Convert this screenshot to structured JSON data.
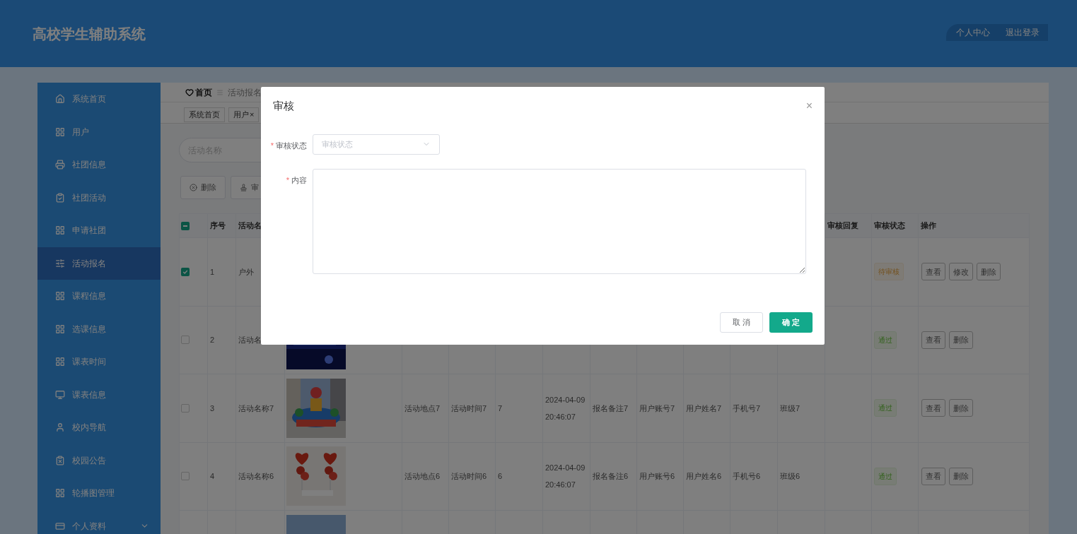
{
  "header": {
    "title": "高校学生辅助系统",
    "links": [
      {
        "label": "个人中心"
      },
      {
        "label": "退出登录"
      }
    ]
  },
  "sidebar": {
    "items": [
      {
        "label": "系统首页",
        "selected": false
      },
      {
        "label": "用户",
        "selected": false
      },
      {
        "label": "社团信息",
        "selected": false
      },
      {
        "label": "社团活动",
        "selected": false
      },
      {
        "label": "申请社团",
        "selected": false
      },
      {
        "label": "活动报名",
        "selected": true
      },
      {
        "label": "课程信息",
        "selected": false
      },
      {
        "label": "选课信息",
        "selected": false
      },
      {
        "label": "课表时间",
        "selected": false
      },
      {
        "label": "课表信息",
        "selected": false
      },
      {
        "label": "校内导航",
        "selected": false
      },
      {
        "label": "校园公告",
        "selected": false
      },
      {
        "label": "轮播图管理",
        "selected": false
      },
      {
        "label": "个人资料",
        "selected": false,
        "expandable": true
      }
    ]
  },
  "breadcrumb": [
    {
      "label": "首页"
    },
    {
      "label": "活动报名"
    }
  ],
  "tabs": [
    {
      "label": "系统首页"
    },
    {
      "label": "用户",
      "close": "×"
    }
  ],
  "search": {
    "placeholder": "活动名称"
  },
  "toolbar": [
    {
      "label": "删除",
      "kind": "delete"
    },
    {
      "label": "审",
      "kind": "review"
    }
  ],
  "table": {
    "header_checkbox": {
      "indeterminate": true
    },
    "columns": {
      "index": "序号",
      "name": "活动名",
      "reply": "审核回复",
      "status": "审核状态",
      "actions": "操作"
    },
    "rows": [
      {
        "checked": true,
        "index": "1",
        "name": "户外",
        "status": "待审核",
        "kind": "pending",
        "actions": [
          {
            "label": "查看"
          },
          {
            "label": "修改"
          },
          {
            "label": "删除"
          }
        ]
      },
      {
        "checked": false,
        "index": "2",
        "name": "活动名",
        "image": {
          "kind": "picture"
        },
        "status": "通过",
        "kind": "pass",
        "actions": [
          {
            "label": "查看"
          },
          {
            "label": "删除"
          }
        ]
      },
      {
        "checked": false,
        "index": "3",
        "name": "活动名称7",
        "image": {
          "kind": "picture"
        },
        "location": "活动地点7",
        "time": "活动时间7",
        "count": "7",
        "date": "2024-04-09 20:46:07",
        "note": "报名备注7",
        "account": "用户账号7",
        "username": "用户姓名7",
        "phone": "手机号7",
        "class": "班级7",
        "status": "通过",
        "kind": "pass",
        "actions": [
          {
            "label": "查看"
          },
          {
            "label": "删除"
          }
        ]
      },
      {
        "checked": false,
        "index": "4",
        "name": "活动名称6",
        "image": {
          "kind": "picture"
        },
        "location": "活动地点6",
        "time": "活动时间6",
        "count": "6",
        "date": "2024-04-09 20:46:07",
        "note": "报名备注6",
        "account": "用户账号6",
        "username": "用户姓名6",
        "phone": "手机号6",
        "class": "班级6",
        "status": "通过",
        "kind": "pass",
        "actions": [
          {
            "label": "查看"
          },
          {
            "label": "删除"
          }
        ]
      },
      {
        "image": {
          "kind": "picture"
        }
      }
    ]
  },
  "dialog": {
    "title": "审核",
    "close": "×",
    "fields": [
      {
        "label": "审核状态",
        "required_mark": "*",
        "kind": "select",
        "placeholder": "审核状态"
      },
      {
        "label": "内容",
        "required_mark": "*",
        "kind": "textarea"
      }
    ],
    "buttons": [
      {
        "label": "取 消",
        "kind": "default"
      },
      {
        "label": "确 定",
        "kind": "primary"
      }
    ]
  }
}
